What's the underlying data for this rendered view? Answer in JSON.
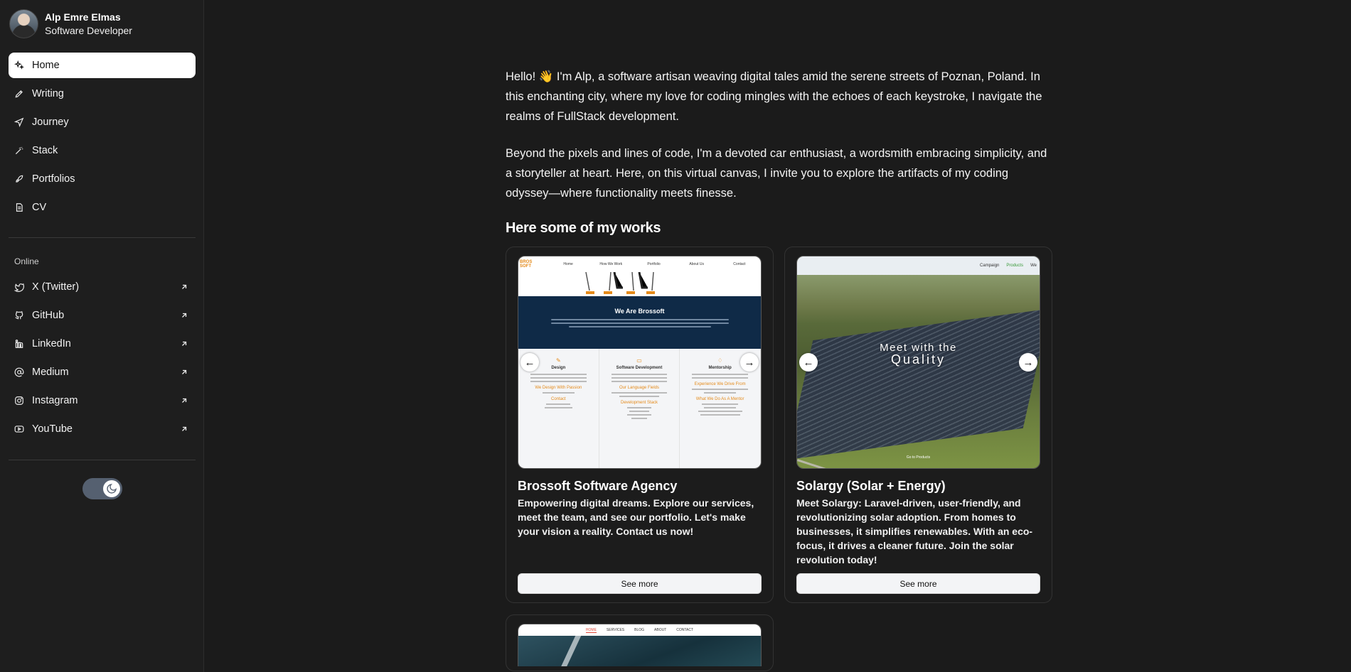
{
  "profile": {
    "name": "Alp Emre Elmas",
    "role": "Software Developer"
  },
  "nav": {
    "items": [
      {
        "label": "Home",
        "icon": "sparkles-icon",
        "active": true
      },
      {
        "label": "Writing",
        "icon": "pen-icon"
      },
      {
        "label": "Journey",
        "icon": "navigation-icon"
      },
      {
        "label": "Stack",
        "icon": "wand-icon"
      },
      {
        "label": "Portfolios",
        "icon": "rocket-icon"
      },
      {
        "label": "CV",
        "icon": "file-icon"
      }
    ]
  },
  "online": {
    "section_label": "Online",
    "items": [
      {
        "label": "X (Twitter)",
        "icon": "twitter-icon"
      },
      {
        "label": "GitHub",
        "icon": "github-icon"
      },
      {
        "label": "LinkedIn",
        "icon": "linkedin-icon"
      },
      {
        "label": "Medium",
        "icon": "at-sign-icon"
      },
      {
        "label": "Instagram",
        "icon": "instagram-icon"
      },
      {
        "label": "YouTube",
        "icon": "youtube-icon"
      }
    ]
  },
  "theme_toggle": {
    "icon": "moon-icon",
    "state": "dark"
  },
  "main": {
    "intro": "Hello! 👋 I'm Alp, a software artisan weaving digital tales amid the serene streets of Poznan, Poland. In this enchanting city, where my love for coding mingles with the echoes of each keystroke, I navigate the realms of FullStack development.",
    "intro2": "Beyond the pixels and lines of code, I'm a devoted car enthusiast, a wordsmith embracing simplicity, and a storyteller at heart. Here, on this virtual canvas, I invite you to explore the artifacts of my coding odyssey—where functionality meets finesse.",
    "works_title": "Here some of my works"
  },
  "works": [
    {
      "title": "Brossoft Software Agency",
      "description": "Empowering digital dreams. Explore our services, meet the team, and see our portfolio. Let's make your vision a reality. Contact us now!",
      "button": "See more",
      "shot": {
        "logo": "BROS\nSOFT",
        "nav": [
          "Home",
          "How We Work",
          "Portfolio",
          "About Us",
          "Contact"
        ],
        "band_title": "We Are Brossoft",
        "cols": [
          {
            "title": "Design",
            "sub": "We Design With Passion",
            "sub2": "Contact"
          },
          {
            "title": "Software Development",
            "sub": "Our Language Fields",
            "sub2": "Development Stack"
          },
          {
            "title": "Mentorship",
            "sub": "Experience We Drive From",
            "sub2": "What We Do As A Mentor"
          }
        ]
      }
    },
    {
      "title": "Solargy (Solar + Energy)",
      "description": "Meet Solargy: Laravel-driven, user-friendly, and revolutionizing solar adoption. From homes to businesses, it simplifies renewables. With an eco-focus, it drives a cleaner future. Join the solar revolution today!",
      "button": "See more",
      "shot": {
        "nav": [
          "Campaign",
          "Products",
          "We"
        ],
        "headline_1": "Meet with the",
        "headline_2": "Quality",
        "footer": "Go to Products"
      }
    },
    {
      "shot": {
        "nav": [
          "HOME",
          "SERVICES",
          "BLOG",
          "ABOUT",
          "CONTACT"
        ]
      }
    }
  ]
}
